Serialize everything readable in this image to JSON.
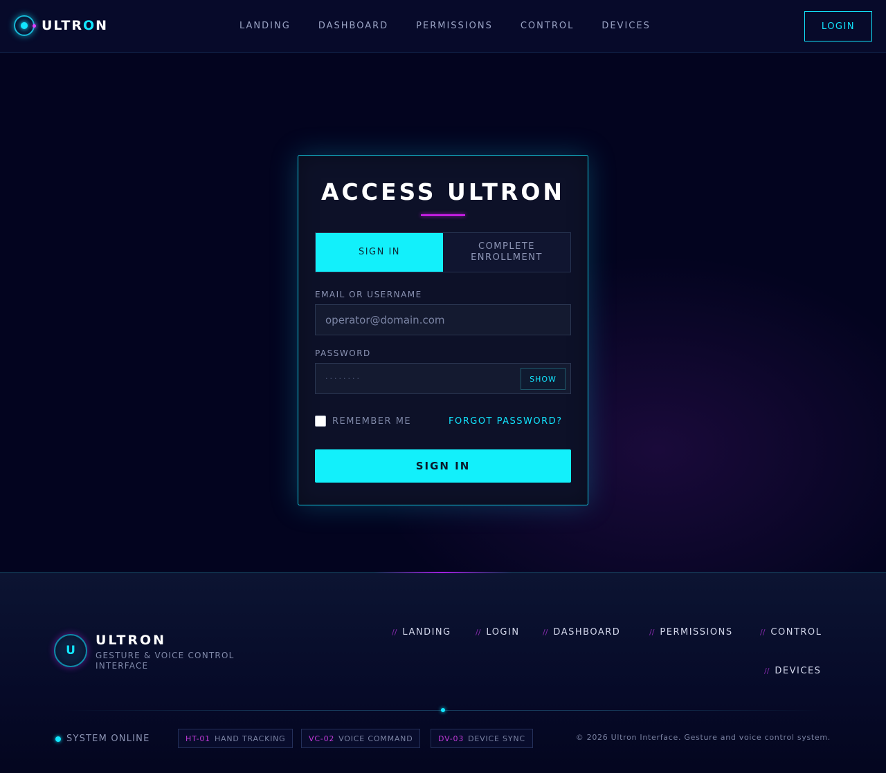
{
  "header": {
    "brand": {
      "prefix": "ULTR",
      "accent": "O",
      "suffix": "N"
    },
    "nav": [
      "LANDING",
      "DASHBOARD",
      "PERMISSIONS",
      "CONTROL",
      "DEVICES"
    ],
    "login_label": "LOGIN"
  },
  "card": {
    "title": "ACCESS ULTRON",
    "tabs": [
      {
        "label": "SIGN IN",
        "active": true
      },
      {
        "label": "COMPLETE ENROLLMENT",
        "active": false
      }
    ],
    "email": {
      "label": "EMAIL OR USERNAME",
      "placeholder": "operator@domain.com",
      "value": ""
    },
    "password": {
      "label": "PASSWORD",
      "masked_value": "········",
      "show_label": "SHOW"
    },
    "remember": {
      "label": "REMEMBER ME",
      "checked": false
    },
    "forgot_label": "FORGOT PASSWORD?",
    "submit_label": "SIGN IN"
  },
  "footer": {
    "logo_letter": "U",
    "name": "ULTRON",
    "tagline": "GESTURE & VOICE CONTROL INTERFACE",
    "links": [
      "LANDING",
      "LOGIN",
      "DASHBOARD",
      "PERMISSIONS",
      "CONTROL",
      "DEVICES"
    ],
    "link_prefix": "//",
    "status": "SYSTEM ONLINE",
    "badges": [
      {
        "code": "HT-01",
        "label": "HAND TRACKING"
      },
      {
        "code": "VC-02",
        "label": "VOICE COMMAND"
      },
      {
        "code": "DV-03",
        "label": "DEVICE SYNC"
      }
    ],
    "copyright": "© 2026 Ultron Interface. Gesture and voice control system."
  },
  "colors": {
    "accent": "#12f0fb",
    "magenta": "#e020ff",
    "background": "#03041f"
  }
}
